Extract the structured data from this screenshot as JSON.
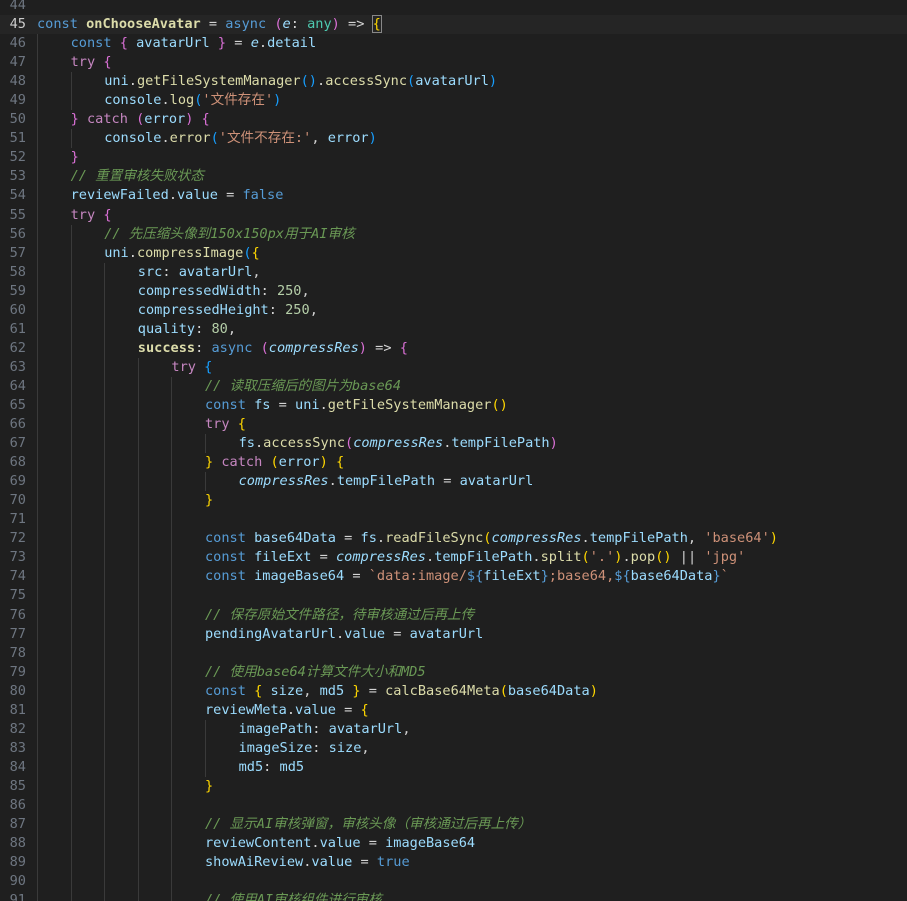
{
  "editor": {
    "current_line": "45",
    "lines": [
      {
        "n": "44",
        "indent": 0,
        "tokens": []
      },
      {
        "n": "45",
        "indent": 0,
        "current": true,
        "tokens": [
          [
            "kw",
            "const "
          ],
          [
            "fnb",
            "onChooseAvatar"
          ],
          [
            "pun",
            " = "
          ],
          [
            "kw",
            "async "
          ],
          [
            "b2",
            "("
          ],
          [
            "prm",
            "e"
          ],
          [
            "pun",
            ": "
          ],
          [
            "ty",
            "any"
          ],
          [
            "b2",
            ")"
          ],
          [
            "pun",
            " => "
          ],
          [
            "b1 bm",
            "{"
          ]
        ]
      },
      {
        "n": "46",
        "indent": 1,
        "tokens": [
          [
            "kw",
            "const "
          ],
          [
            "b2",
            "{ "
          ],
          [
            "var",
            "avatarUrl"
          ],
          [
            "b2",
            " }"
          ],
          [
            "pun",
            " = "
          ],
          [
            "prm",
            "e"
          ],
          [
            "pun",
            "."
          ],
          [
            "pty",
            "detail"
          ]
        ]
      },
      {
        "n": "47",
        "indent": 1,
        "tokens": [
          [
            "ctl",
            "try "
          ],
          [
            "b2",
            "{"
          ]
        ]
      },
      {
        "n": "48",
        "indent": 2,
        "tokens": [
          [
            "var",
            "uni"
          ],
          [
            "pun",
            "."
          ],
          [
            "fn",
            "getFileSystemManager"
          ],
          [
            "b3",
            "()"
          ],
          [
            "pun",
            "."
          ],
          [
            "fn",
            "accessSync"
          ],
          [
            "b3",
            "("
          ],
          [
            "var",
            "avatarUrl"
          ],
          [
            "b3",
            ")"
          ]
        ]
      },
      {
        "n": "49",
        "indent": 2,
        "tokens": [
          [
            "var",
            "console"
          ],
          [
            "pun",
            "."
          ],
          [
            "fn",
            "log"
          ],
          [
            "b3",
            "("
          ],
          [
            "str",
            "'文件存在'"
          ],
          [
            "b3",
            ")"
          ]
        ]
      },
      {
        "n": "50",
        "indent": 1,
        "tokens": [
          [
            "b2",
            "} "
          ],
          [
            "ctl",
            "catch "
          ],
          [
            "b2",
            "("
          ],
          [
            "var",
            "error"
          ],
          [
            "b2",
            ") {"
          ]
        ]
      },
      {
        "n": "51",
        "indent": 2,
        "tokens": [
          [
            "var",
            "console"
          ],
          [
            "pun",
            "."
          ],
          [
            "fn",
            "error"
          ],
          [
            "b3",
            "("
          ],
          [
            "str",
            "'文件不存在:'"
          ],
          [
            "pun",
            ", "
          ],
          [
            "var",
            "error"
          ],
          [
            "b3",
            ")"
          ]
        ]
      },
      {
        "n": "52",
        "indent": 1,
        "tokens": [
          [
            "b2",
            "}"
          ]
        ]
      },
      {
        "n": "53",
        "indent": 1,
        "tokens": [
          [
            "cmt",
            "// 重置审核失败状态"
          ]
        ]
      },
      {
        "n": "54",
        "indent": 1,
        "tokens": [
          [
            "var",
            "reviewFailed"
          ],
          [
            "pun",
            "."
          ],
          [
            "pty",
            "value"
          ],
          [
            "pun",
            " = "
          ],
          [
            "kw",
            "false"
          ]
        ]
      },
      {
        "n": "55",
        "indent": 1,
        "tokens": [
          [
            "ctl",
            "try "
          ],
          [
            "b2",
            "{"
          ]
        ]
      },
      {
        "n": "56",
        "indent": 2,
        "tokens": [
          [
            "cmt",
            "// 先压缩头像到150x150px用于AI审核"
          ]
        ]
      },
      {
        "n": "57",
        "indent": 2,
        "tokens": [
          [
            "var",
            "uni"
          ],
          [
            "pun",
            "."
          ],
          [
            "fn",
            "compressImage"
          ],
          [
            "b3",
            "("
          ],
          [
            "b1",
            "{"
          ]
        ]
      },
      {
        "n": "58",
        "indent": 3,
        "tokens": [
          [
            "pty",
            "src"
          ],
          [
            "pun",
            ": "
          ],
          [
            "var",
            "avatarUrl"
          ],
          [
            "pun",
            ","
          ]
        ]
      },
      {
        "n": "59",
        "indent": 3,
        "tokens": [
          [
            "pty",
            "compressedWidth"
          ],
          [
            "pun",
            ": "
          ],
          [
            "num",
            "250"
          ],
          [
            "pun",
            ","
          ]
        ]
      },
      {
        "n": "60",
        "indent": 3,
        "tokens": [
          [
            "pty",
            "compressedHeight"
          ],
          [
            "pun",
            ": "
          ],
          [
            "num",
            "250"
          ],
          [
            "pun",
            ","
          ]
        ]
      },
      {
        "n": "61",
        "indent": 3,
        "tokens": [
          [
            "pty",
            "quality"
          ],
          [
            "pun",
            ": "
          ],
          [
            "num",
            "80"
          ],
          [
            "pun",
            ","
          ]
        ]
      },
      {
        "n": "62",
        "indent": 3,
        "tokens": [
          [
            "fnb",
            "success"
          ],
          [
            "pun",
            ": "
          ],
          [
            "kw",
            "async "
          ],
          [
            "b2",
            "("
          ],
          [
            "prm",
            "compressRes"
          ],
          [
            "b2",
            ")"
          ],
          [
            "pun",
            " => "
          ],
          [
            "b2",
            "{"
          ]
        ]
      },
      {
        "n": "63",
        "indent": 4,
        "tokens": [
          [
            "ctl",
            "try "
          ],
          [
            "b3",
            "{"
          ]
        ]
      },
      {
        "n": "64",
        "indent": 5,
        "tokens": [
          [
            "cmt",
            "// 读取压缩后的图片为base64"
          ]
        ]
      },
      {
        "n": "65",
        "indent": 5,
        "tokens": [
          [
            "kw",
            "const "
          ],
          [
            "var",
            "fs"
          ],
          [
            "pun",
            " = "
          ],
          [
            "var",
            "uni"
          ],
          [
            "pun",
            "."
          ],
          [
            "fn",
            "getFileSystemManager"
          ],
          [
            "b1",
            "()"
          ]
        ]
      },
      {
        "n": "66",
        "indent": 5,
        "tokens": [
          [
            "ctl",
            "try "
          ],
          [
            "b1",
            "{"
          ]
        ]
      },
      {
        "n": "67",
        "indent": 6,
        "tokens": [
          [
            "var",
            "fs"
          ],
          [
            "pun",
            "."
          ],
          [
            "fn",
            "accessSync"
          ],
          [
            "b2",
            "("
          ],
          [
            "prm",
            "compressRes"
          ],
          [
            "pun",
            "."
          ],
          [
            "pty",
            "tempFilePath"
          ],
          [
            "b2",
            ")"
          ]
        ]
      },
      {
        "n": "68",
        "indent": 5,
        "tokens": [
          [
            "b1",
            "} "
          ],
          [
            "ctl",
            "catch "
          ],
          [
            "b1",
            "("
          ],
          [
            "var",
            "error"
          ],
          [
            "b1",
            ") {"
          ]
        ]
      },
      {
        "n": "69",
        "indent": 6,
        "tokens": [
          [
            "prm",
            "compressRes"
          ],
          [
            "pun",
            "."
          ],
          [
            "pty",
            "tempFilePath"
          ],
          [
            "pun",
            " = "
          ],
          [
            "var",
            "avatarUrl"
          ]
        ]
      },
      {
        "n": "70",
        "indent": 5,
        "tokens": [
          [
            "b1",
            "}"
          ]
        ]
      },
      {
        "n": "71",
        "indent": 5,
        "tokens": []
      },
      {
        "n": "72",
        "indent": 5,
        "tokens": [
          [
            "kw",
            "const "
          ],
          [
            "var",
            "base64Data"
          ],
          [
            "pun",
            " = "
          ],
          [
            "var",
            "fs"
          ],
          [
            "pun",
            "."
          ],
          [
            "fn",
            "readFileSync"
          ],
          [
            "b1",
            "("
          ],
          [
            "prm",
            "compressRes"
          ],
          [
            "pun",
            "."
          ],
          [
            "pty",
            "tempFilePath"
          ],
          [
            "pun",
            ", "
          ],
          [
            "str",
            "'base64'"
          ],
          [
            "b1",
            ")"
          ]
        ]
      },
      {
        "n": "73",
        "indent": 5,
        "tokens": [
          [
            "kw",
            "const "
          ],
          [
            "var",
            "fileExt"
          ],
          [
            "pun",
            " = "
          ],
          [
            "prm",
            "compressRes"
          ],
          [
            "pun",
            "."
          ],
          [
            "pty",
            "tempFilePath"
          ],
          [
            "pun",
            "."
          ],
          [
            "fn",
            "split"
          ],
          [
            "b1",
            "("
          ],
          [
            "str",
            "'.'"
          ],
          [
            "b1",
            ")"
          ],
          [
            "pun",
            "."
          ],
          [
            "fn",
            "pop"
          ],
          [
            "b1",
            "()"
          ],
          [
            "pun",
            " || "
          ],
          [
            "str",
            "'jpg'"
          ]
        ]
      },
      {
        "n": "74",
        "indent": 5,
        "tokens": [
          [
            "kw",
            "const "
          ],
          [
            "var",
            "imageBase64"
          ],
          [
            "pun",
            " = "
          ],
          [
            "str",
            "`data:image/"
          ],
          [
            "kw",
            "${"
          ],
          [
            "var",
            "fileExt"
          ],
          [
            "kw",
            "}"
          ],
          [
            "str",
            ";base64,"
          ],
          [
            "kw",
            "${"
          ],
          [
            "var",
            "base64Data"
          ],
          [
            "kw",
            "}"
          ],
          [
            "str",
            "`"
          ]
        ]
      },
      {
        "n": "75",
        "indent": 5,
        "tokens": []
      },
      {
        "n": "76",
        "indent": 5,
        "tokens": [
          [
            "cmt",
            "// 保存原始文件路径，待审核通过后再上传"
          ]
        ]
      },
      {
        "n": "77",
        "indent": 5,
        "tokens": [
          [
            "var",
            "pendingAvatarUrl"
          ],
          [
            "pun",
            "."
          ],
          [
            "pty",
            "value"
          ],
          [
            "pun",
            " = "
          ],
          [
            "var",
            "avatarUrl"
          ]
        ]
      },
      {
        "n": "78",
        "indent": 5,
        "tokens": []
      },
      {
        "n": "79",
        "indent": 5,
        "tokens": [
          [
            "cmt",
            "// 使用base64计算文件大小和MD5"
          ]
        ]
      },
      {
        "n": "80",
        "indent": 5,
        "tokens": [
          [
            "kw",
            "const "
          ],
          [
            "b1",
            "{ "
          ],
          [
            "var",
            "size"
          ],
          [
            "pun",
            ", "
          ],
          [
            "var",
            "md5"
          ],
          [
            "b1",
            " }"
          ],
          [
            "pun",
            " = "
          ],
          [
            "fn",
            "calcBase64Meta"
          ],
          [
            "b1",
            "("
          ],
          [
            "var",
            "base64Data"
          ],
          [
            "b1",
            ")"
          ]
        ]
      },
      {
        "n": "81",
        "indent": 5,
        "tokens": [
          [
            "var",
            "reviewMeta"
          ],
          [
            "pun",
            "."
          ],
          [
            "pty",
            "value"
          ],
          [
            "pun",
            " = "
          ],
          [
            "b1",
            "{"
          ]
        ]
      },
      {
        "n": "82",
        "indent": 6,
        "tokens": [
          [
            "pty",
            "imagePath"
          ],
          [
            "pun",
            ": "
          ],
          [
            "var",
            "avatarUrl"
          ],
          [
            "pun",
            ","
          ]
        ]
      },
      {
        "n": "83",
        "indent": 6,
        "tokens": [
          [
            "pty",
            "imageSize"
          ],
          [
            "pun",
            ": "
          ],
          [
            "var",
            "size"
          ],
          [
            "pun",
            ","
          ]
        ]
      },
      {
        "n": "84",
        "indent": 6,
        "tokens": [
          [
            "pty",
            "md5"
          ],
          [
            "pun",
            ": "
          ],
          [
            "var",
            "md5"
          ]
        ]
      },
      {
        "n": "85",
        "indent": 5,
        "tokens": [
          [
            "b1",
            "}"
          ]
        ]
      },
      {
        "n": "86",
        "indent": 5,
        "tokens": []
      },
      {
        "n": "87",
        "indent": 5,
        "tokens": [
          [
            "cmt",
            "// 显示AI审核弹窗，审核头像（审核通过后再上传）"
          ]
        ]
      },
      {
        "n": "88",
        "indent": 5,
        "tokens": [
          [
            "var",
            "reviewContent"
          ],
          [
            "pun",
            "."
          ],
          [
            "pty",
            "value"
          ],
          [
            "pun",
            " = "
          ],
          [
            "var",
            "imageBase64"
          ]
        ]
      },
      {
        "n": "89",
        "indent": 5,
        "tokens": [
          [
            "var",
            "showAiReview"
          ],
          [
            "pun",
            "."
          ],
          [
            "pty",
            "value"
          ],
          [
            "pun",
            " = "
          ],
          [
            "kw",
            "true"
          ]
        ]
      },
      {
        "n": "90",
        "indent": 5,
        "tokens": []
      },
      {
        "n": "91",
        "indent": 5,
        "tokens": [
          [
            "cmt",
            "// 使用AI审核组件进行审核"
          ]
        ]
      }
    ]
  }
}
